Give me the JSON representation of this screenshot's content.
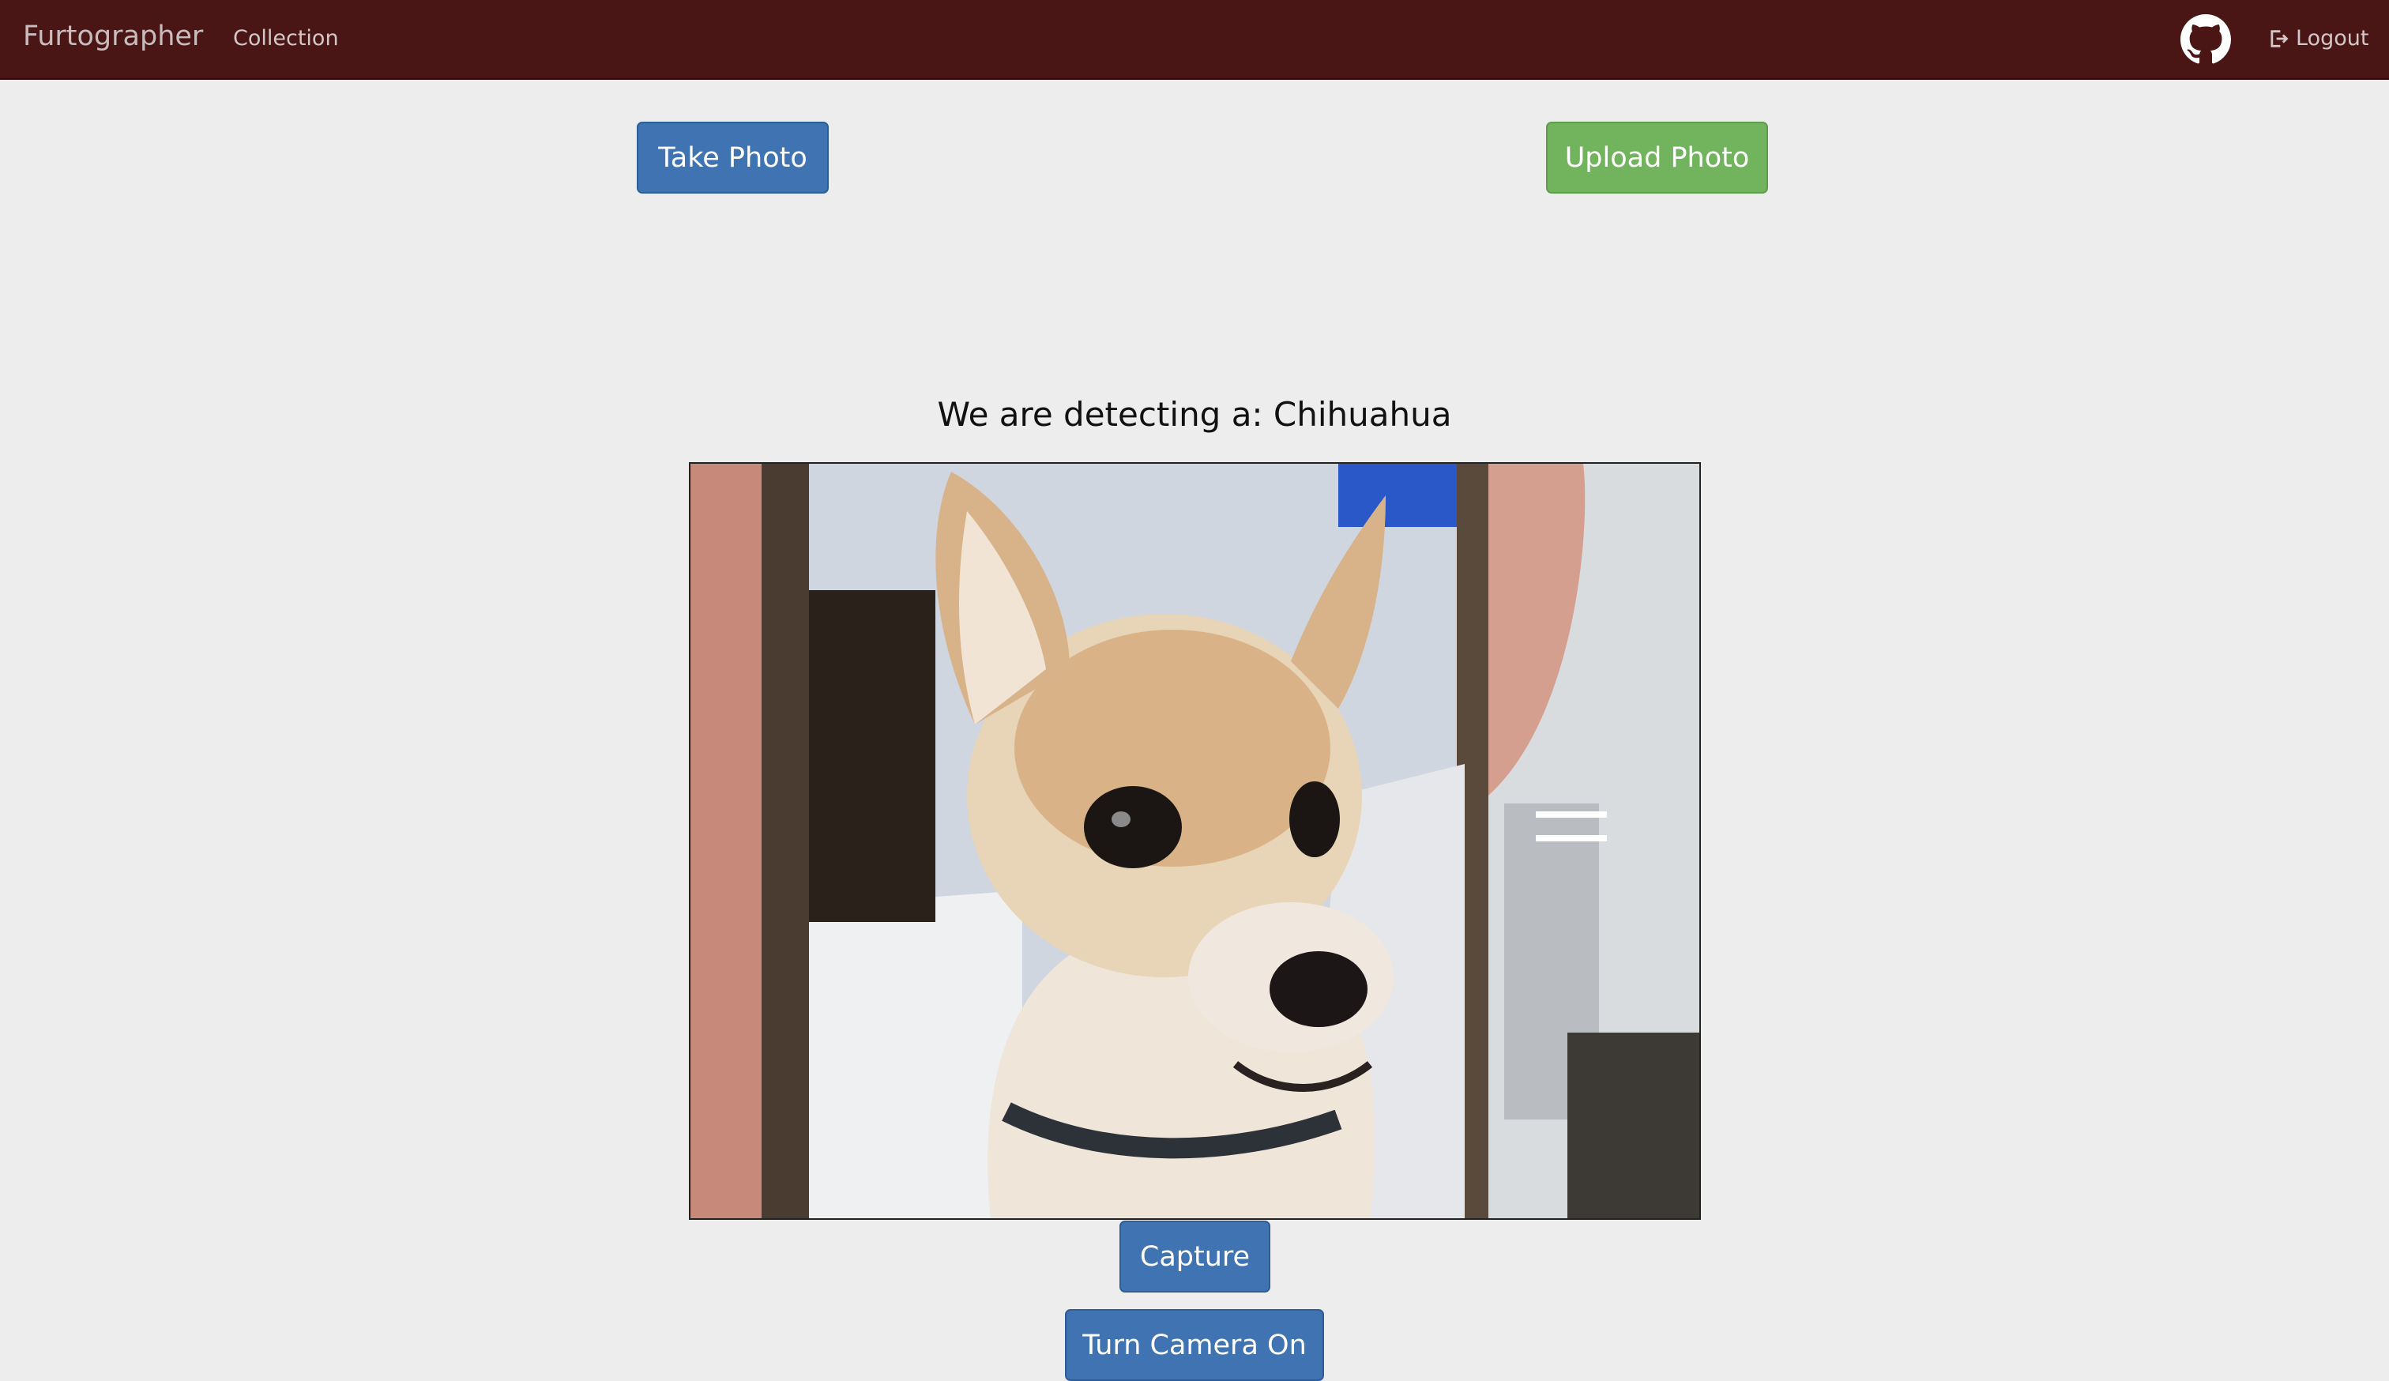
{
  "navbar": {
    "brand": "Furtographer",
    "links": [
      "Collection"
    ],
    "logout_label": "Logout",
    "background": "#4a1515"
  },
  "actions": {
    "take_photo_label": "Take Photo",
    "upload_photo_label": "Upload Photo"
  },
  "detection": {
    "text": "We are detecting a: Chihuahua"
  },
  "camera": {
    "capture_label": "Capture",
    "turn_on_label": "Turn Camera On"
  },
  "icons": {
    "github": "github-icon",
    "logout": "logout-icon"
  },
  "colors": {
    "primary": "#3f73b2",
    "success": "#72b45e",
    "page_bg": "#ededed"
  }
}
